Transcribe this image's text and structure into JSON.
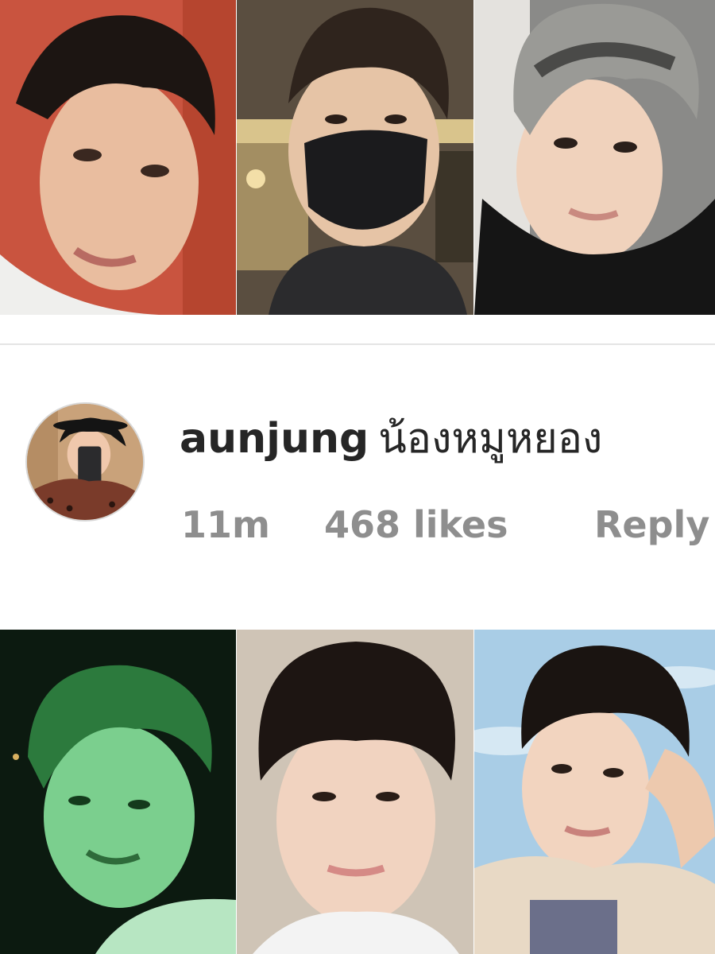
{
  "comment": {
    "username": "aunjung",
    "text": "น้องหมูหยอง",
    "time": "11m",
    "likes": "468 likes",
    "reply_label": "Reply"
  },
  "photos": {
    "top": [
      {
        "subject": "man-selfie-orange-wall",
        "bg_color": "#c9543f"
      },
      {
        "subject": "man-black-mask-mall",
        "bg_color": "#5a4e40"
      },
      {
        "subject": "man-grey-hair-black-shirt",
        "bg_color": "#8a8a88"
      }
    ],
    "bottom": [
      {
        "subject": "man-green-light-night",
        "bg_color": "#0c1a10"
      },
      {
        "subject": "man-curly-hair-beige-wall",
        "bg_color": "#cfc4b6"
      },
      {
        "subject": "man-blue-sky-hand-on-head",
        "bg_color": "#a9cde6"
      }
    ]
  },
  "avatar": {
    "subject": "user-avatar-mirror-selfie"
  },
  "colors": {
    "text_primary": "#262626",
    "text_secondary": "#8e8e8e",
    "divider": "#e4e4e4"
  }
}
